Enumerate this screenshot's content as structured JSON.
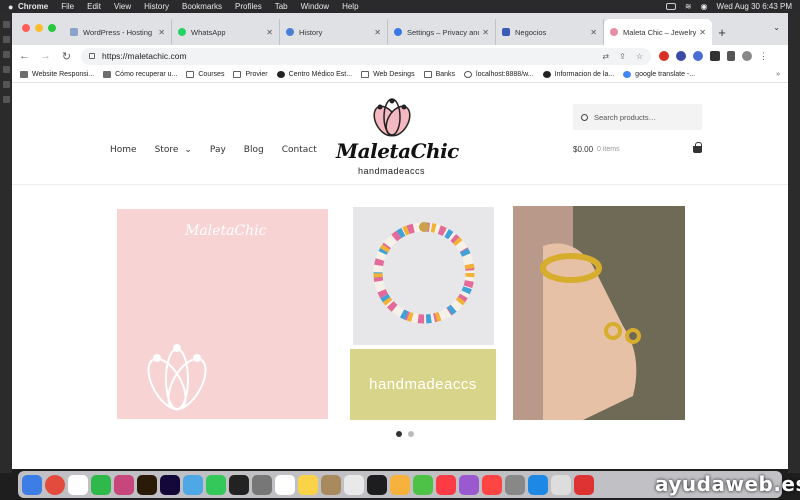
{
  "menubar": {
    "app": "Chrome",
    "items": [
      "File",
      "Edit",
      "View",
      "History",
      "Bookmarks",
      "Profiles",
      "Tab",
      "Window",
      "Help"
    ],
    "datetime": "Wed Aug 30  6:43 PM"
  },
  "tabs": [
    {
      "label": "WordPress - Hosting",
      "color": "#8aa3c8"
    },
    {
      "label": "WhatsApp",
      "color": "#25d366"
    },
    {
      "label": "History",
      "color": "#4a7fd8"
    },
    {
      "label": "Settings – Privacy and s",
      "color": "#3b78e7"
    },
    {
      "label": "Negocios",
      "color": "#3b5bb5"
    },
    {
      "label": "Maleta Chic – Jewelry a",
      "color": "#e98fa5"
    }
  ],
  "toolbar": {
    "url": "https://maletachic.com"
  },
  "bookmarks": [
    {
      "label": "Website Responsi...",
      "icon": "page-icon"
    },
    {
      "label": "Cómo recuperar u...",
      "icon": "page-icon"
    },
    {
      "label": "Courses",
      "icon": "folder-icon"
    },
    {
      "label": "Provier",
      "icon": "folder-icon"
    },
    {
      "label": "Centro Médico Est...",
      "icon": "globe-icon"
    },
    {
      "label": "Web Desings",
      "icon": "folder-icon"
    },
    {
      "label": "Banks",
      "icon": "folder-icon"
    },
    {
      "label": "localhost:8888/w...",
      "icon": "globe-icon"
    },
    {
      "label": "Informacion de la...",
      "icon": "globe-icon"
    },
    {
      "label": "google translate -...",
      "icon": "google-icon"
    }
  ],
  "site": {
    "nav": [
      "Home",
      "Store",
      "Pay",
      "Blog",
      "Contact"
    ],
    "brand": "MaletaChic",
    "tagline": "handmadeaccs",
    "search_placeholder": "Search products…",
    "cart_total": "$0.00",
    "cart_items": "0 items",
    "slide_pink_title": "MaletaChic",
    "slide_green_text": "handmadeaccs",
    "accent": "#f7d3d4",
    "green": "#d8d58a"
  },
  "watermark": "ayudaweb.es"
}
